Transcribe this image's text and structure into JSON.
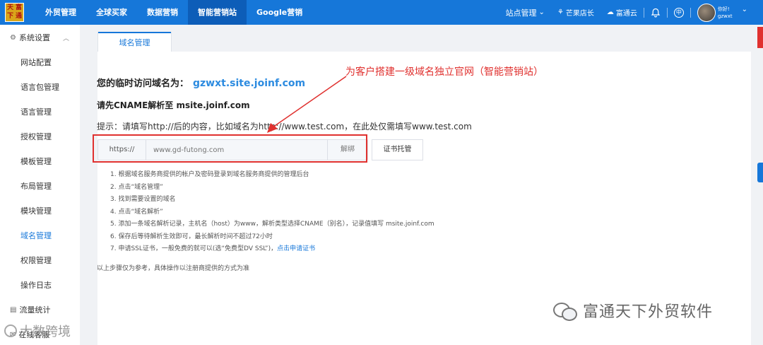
{
  "logo": {
    "chars": [
      "天",
      "富",
      "下",
      "通"
    ]
  },
  "nav": {
    "items": [
      {
        "label": "外贸管理"
      },
      {
        "label": "全球买家"
      },
      {
        "label": "数据营销"
      },
      {
        "label": "智能营销站"
      },
      {
        "label": "Google营销"
      }
    ],
    "active_index": 3
  },
  "topright": {
    "site_manage": "站点管理",
    "mango": "芒果店长",
    "futong_cloud": "富通云",
    "user_greeting": "你好!",
    "username": "gzwxt"
  },
  "sidebar": {
    "section1": "系统设置",
    "items": [
      {
        "label": "网站配置"
      },
      {
        "label": "语言包管理"
      },
      {
        "label": "语言管理"
      },
      {
        "label": "授权管理"
      },
      {
        "label": "模板管理"
      },
      {
        "label": "布局管理"
      },
      {
        "label": "模块管理"
      },
      {
        "label": "域名管理"
      },
      {
        "label": "权限管理"
      },
      {
        "label": "操作日志"
      }
    ],
    "active_label": "域名管理",
    "section2": "流量统计",
    "section3": "在线客服"
  },
  "tab": {
    "label": "域名管理"
  },
  "main": {
    "temp_label": "您的临时访问域名为：",
    "temp_domain": "gzwxt.site.joinf.com",
    "cname_text": "请先CNAME解析至 msite.joinf.com",
    "hint": "提示：请填写http://后的内容，比如域名为http://www.test.com，在此处仅需填写www.test.com",
    "prefix": "https://",
    "input_placeholder": "www.gd-futong.com",
    "bind_button": "解绑",
    "cert_button": "证书托管",
    "steps": [
      "1. 根据域名服务商提供的帐户及密码登录到域名服务商提供的管理后台",
      "2. 点击“域名管理”",
      "3. 找到需要设置的域名",
      "4. 点击“域名解析”",
      "5. 添加一条域名解析记录，主机名（host）为www，解析类型选择CNAME（别名），记录值填写 msite.joinf.com",
      "6. 保存后等待解析生效即可，最长解析时间不超过72小时",
      "7. 申请SSL证书，一般免费的就可以(选“免费型DV SSL”)，"
    ],
    "step7_link": "点击申请证书",
    "note": "以上步骤仅为参考，具体操作以注册商提供的方式为准"
  },
  "annotation": {
    "text": "为客户搭建一级域名独立官网（智能营销站）",
    "color": "#e0312f"
  },
  "watermark": {
    "text": "富通天下外贸软件",
    "bottom_left": "大数跨境"
  },
  "colors": {
    "primary": "#1677d9",
    "annotation_red": "#e0312f"
  }
}
